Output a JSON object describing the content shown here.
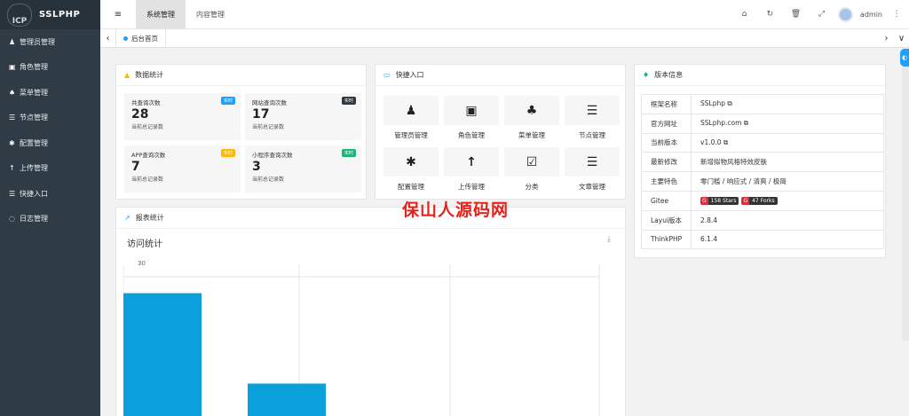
{
  "app": {
    "logo_mark": "ICP",
    "name": "SSLPHP"
  },
  "sidebar": {
    "items": [
      {
        "icon": "user-icon",
        "glyph": "♟",
        "label": "管理员管理"
      },
      {
        "icon": "id-card-icon",
        "glyph": "▣",
        "label": "角色管理"
      },
      {
        "icon": "bell-icon",
        "glyph": "♠",
        "label": "菜单管理"
      },
      {
        "icon": "list-icon",
        "glyph": "☰",
        "label": "节点管理"
      },
      {
        "icon": "asterisk-icon",
        "glyph": "✱",
        "label": "配置管理"
      },
      {
        "icon": "upload-arrow-icon",
        "glyph": "↑",
        "label": "上传管理"
      },
      {
        "icon": "list-icon",
        "glyph": "☰",
        "label": "快捷入口"
      },
      {
        "icon": "log-icon",
        "glyph": "◌",
        "label": "日志管理"
      }
    ]
  },
  "topbar": {
    "menu_glyph": "≡",
    "tabs": [
      {
        "label": "系统管理",
        "active": true
      },
      {
        "label": "内容管理",
        "active": false
      }
    ],
    "tools": [
      "⌂",
      "↻",
      "🗑",
      "⤢"
    ],
    "username": "admin",
    "more_glyph": "⋮"
  },
  "tabbar": {
    "left_arrow": "‹",
    "right_arrow": "›",
    "more_glyph": "∨",
    "current_tab": "后台首页"
  },
  "stats": {
    "title": "数据统计",
    "items": [
      {
        "title": "共查询次数",
        "badge": "实时",
        "badge_color": "#1e9fff",
        "value": "28",
        "sub": "当前总记录数"
      },
      {
        "title": "网站查询次数",
        "badge": "实时",
        "badge_color": "#2f363c",
        "value": "17",
        "sub": "当前总记录数"
      },
      {
        "title": "APP查询次数",
        "badge": "实时",
        "badge_color": "#ffb800",
        "value": "7",
        "sub": "当前总记录数"
      },
      {
        "title": "小程序查询次数",
        "badge": "实时",
        "badge_color": "#16b777",
        "value": "3",
        "sub": "当前总记录数"
      }
    ]
  },
  "quick": {
    "title": "快捷入口",
    "items": [
      {
        "icon": "user-icon",
        "glyph": "♟",
        "label": "管理员管理"
      },
      {
        "icon": "id-card-icon",
        "glyph": "▣",
        "label": "角色管理"
      },
      {
        "icon": "tree-icon",
        "glyph": "♣",
        "label": "菜单管理"
      },
      {
        "icon": "list-icon",
        "glyph": "☰",
        "label": "节点管理"
      },
      {
        "icon": "asterisk-icon",
        "glyph": "✱",
        "label": "配置管理"
      },
      {
        "icon": "upload-arrow-icon",
        "glyph": "↑",
        "label": "上传管理"
      },
      {
        "icon": "calendar-check-icon",
        "glyph": "☑",
        "label": "分类"
      },
      {
        "icon": "list-icon",
        "glyph": "☰",
        "label": "文章管理"
      }
    ]
  },
  "version": {
    "title": "版本信息",
    "rows": [
      {
        "k": "框架名称",
        "v": "SSLphp ⧉"
      },
      {
        "k": "官方网址",
        "v": "SSLphp.com ⧉"
      },
      {
        "k": "当前版本",
        "v": "v1.0.0 ⧉"
      },
      {
        "k": "最新修改",
        "v": "新增拟物风格特效皮肤"
      },
      {
        "k": "主要特色",
        "v": "零门槛 / 响应式 / 清爽 / 极简"
      },
      {
        "k": "Gitee",
        "v": ""
      },
      {
        "k": "Layui版本",
        "v": "2.8.4"
      },
      {
        "k": "ThinkPHP",
        "v": "6.1.4"
      }
    ],
    "gitee_stars": "158 Stars",
    "gitee_forks": "47 Forks"
  },
  "report": {
    "title": "报表统计",
    "chart_title": "访问统计"
  },
  "watermark": "保山人源码网",
  "chart_data": {
    "type": "bar",
    "title": "访问统计",
    "y_tick_labels": [
      "30"
    ],
    "ylim": [
      0,
      30
    ],
    "values": [
      28,
      17
    ],
    "bar_color": "#0aa0dc",
    "grid": true
  }
}
